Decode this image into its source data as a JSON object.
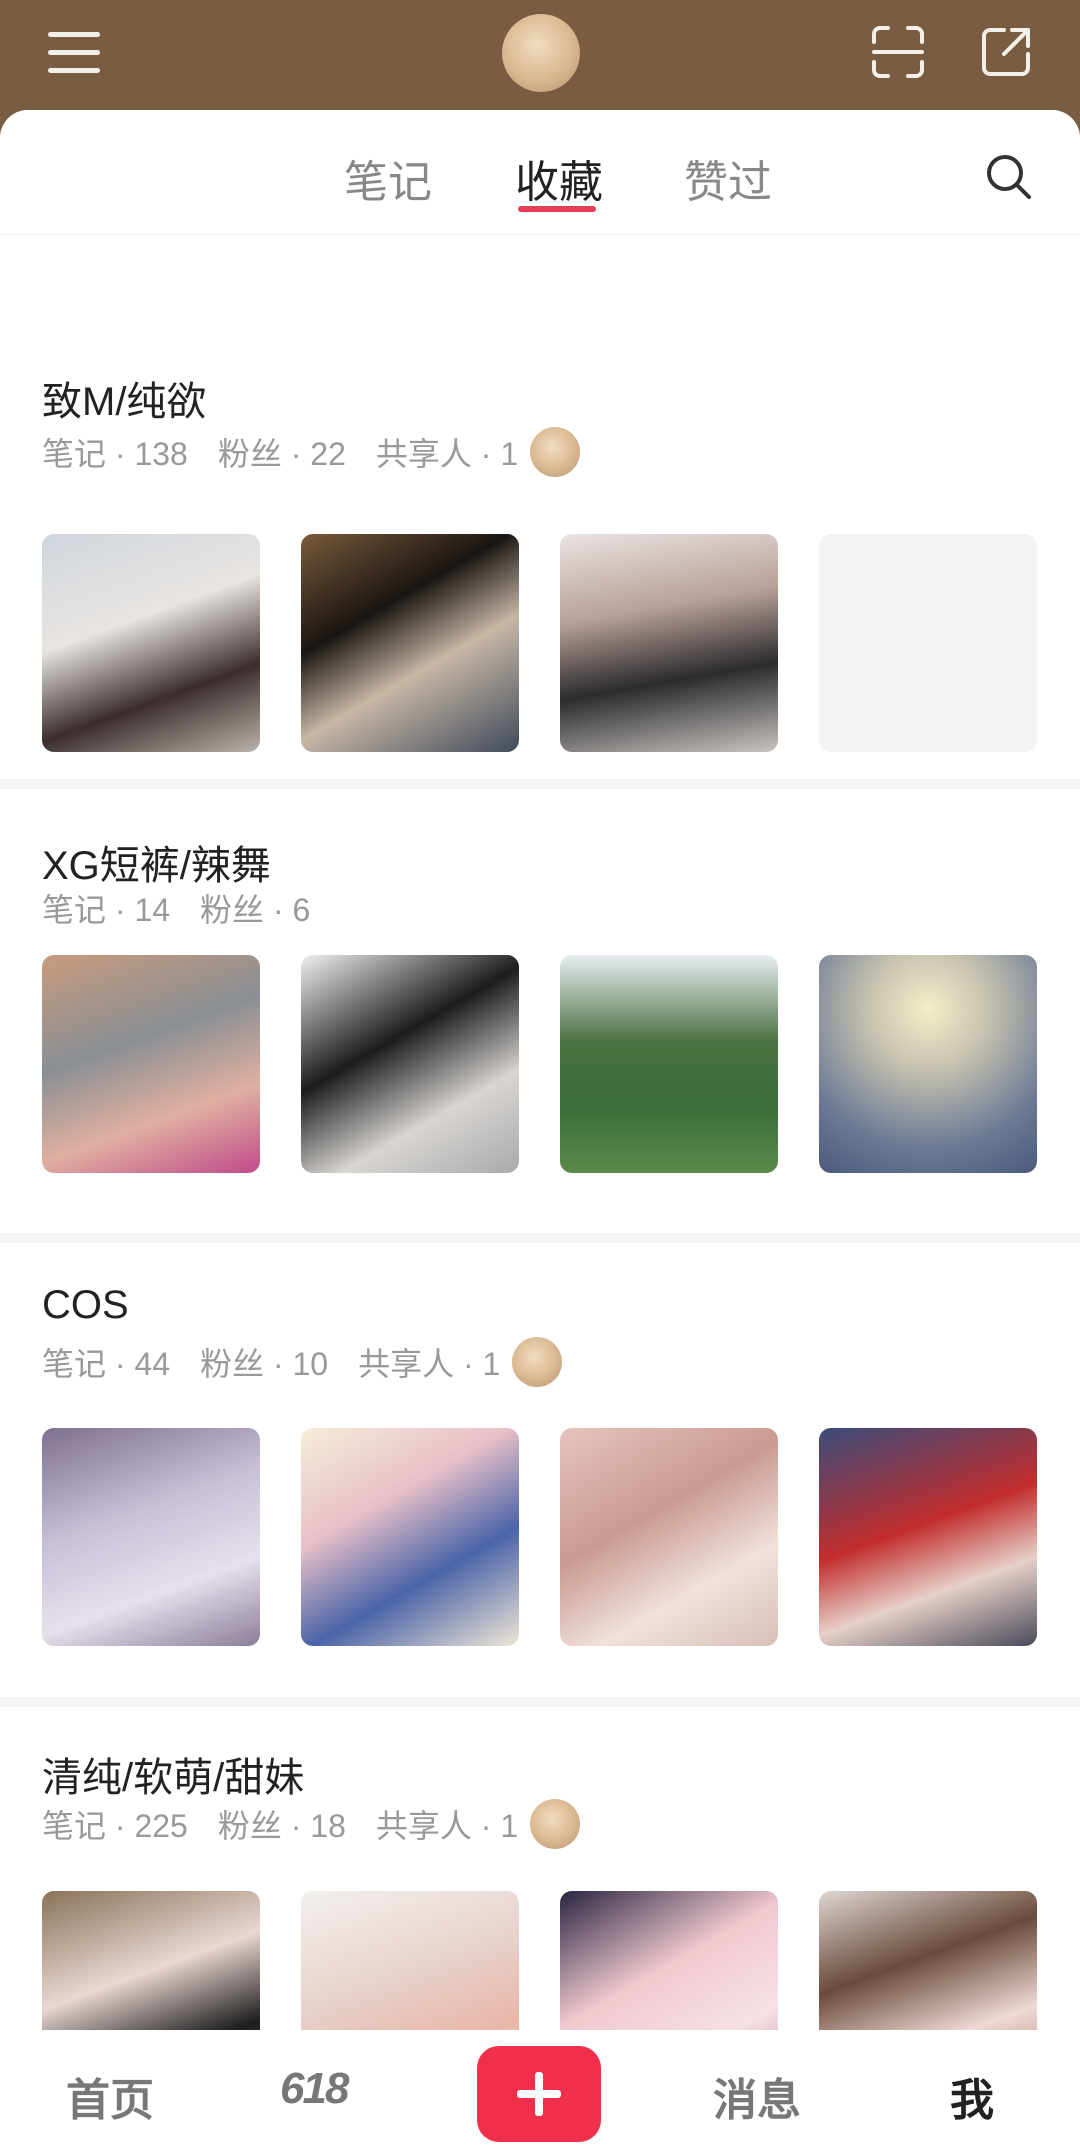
{
  "header": {
    "menu_icon": "menu-icon",
    "scan_icon": "scan-icon",
    "share_icon": "share-icon"
  },
  "tabs": [
    {
      "label": "笔记",
      "active": false
    },
    {
      "label": "收藏",
      "active": true
    },
    {
      "label": "赞过",
      "active": false
    }
  ],
  "boards": [
    {
      "title": "致M/纯欲",
      "notes": "笔记 · 138",
      "fans": "粉丝 · 22",
      "sharers": "共享人 · 1",
      "has_sharer_avatar": true
    },
    {
      "title": "XG短裤/辣舞",
      "notes": "笔记 · 14",
      "fans": "粉丝 · 6",
      "sharers": "",
      "has_sharer_avatar": false
    },
    {
      "title": "COS",
      "notes": "笔记 · 44",
      "fans": "粉丝 · 10",
      "sharers": "共享人 · 1",
      "has_sharer_avatar": true
    },
    {
      "title": "清纯/软萌/甜妹",
      "notes": "笔记 · 225",
      "fans": "粉丝 · 18",
      "sharers": "共享人 · 1",
      "has_sharer_avatar": true
    }
  ],
  "bottom_nav": {
    "home": "首页",
    "promo": "618",
    "messages": "消息",
    "me": "我"
  },
  "colors": {
    "accent": "#e33e57",
    "header_bg": "#7a5c42",
    "plus_button": "#f0304a"
  }
}
